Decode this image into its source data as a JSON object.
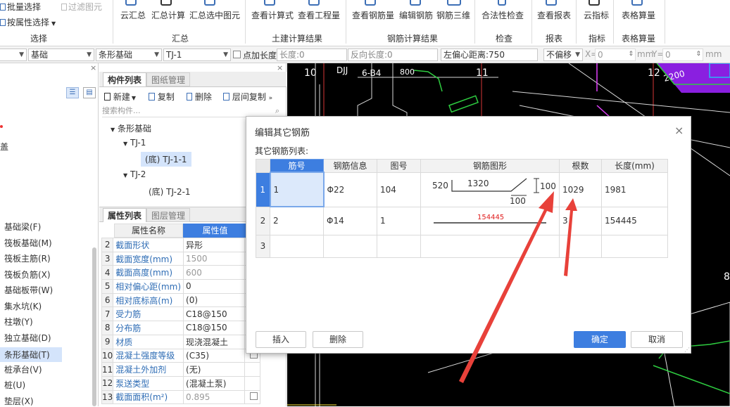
{
  "ribbon": {
    "select_group": {
      "batch_select": "批量选择",
      "filter_select": "过滤图元",
      "select_by_attr": "按属性选择",
      "label": "选择"
    },
    "summary_group": {
      "cloud_summary": "云汇总",
      "summary_calc": "汇总计算",
      "summary_selected": "汇总选中图元",
      "label": "汇总"
    },
    "civil_group": {
      "view_formula": "查看计算式",
      "view_quantity": "查看工程量",
      "label": "土建计算结果"
    },
    "rebar_group": {
      "view_rebar_qty": "查看钢筋量",
      "edit_rebar": "编辑钢筋",
      "rebar_3d": "钢筋三维",
      "label": "钢筋计算结果"
    },
    "check_group": {
      "legality_check": "合法性检查",
      "label": "检查"
    },
    "report_group": {
      "view_report": "查看报表",
      "label": "报表"
    },
    "index_group": {
      "cloud_index": "云指标",
      "label": "指标"
    },
    "table_group": {
      "table_calc": "表格算量",
      "label": "表格算量"
    }
  },
  "toolbar2": {
    "floor_value": "基础",
    "type_value": "条形基础",
    "component_value": "TJ-1",
    "point_length_label": "点加长度",
    "length_label": "长度:",
    "length_value": "0",
    "reverse_label": "反向长度:",
    "reverse_value": "0",
    "left_offset_label": "左偏心距离:",
    "left_offset_value": "750",
    "offset_mode": "不偏移",
    "x_label": "X=",
    "x_value": "0",
    "x_unit": "mm",
    "y_label": "Y=",
    "y_value": "0",
    "y_unit": "mm"
  },
  "nav": {
    "cover_text": "盖",
    "items": [
      "基础梁(F)",
      "筏板基础(M)",
      "筏板主筋(R)",
      "筏板负筋(X)",
      "基础板带(W)",
      "集水坑(K)",
      "柱墩(Y)",
      "独立基础(D)",
      "条形基础(T)",
      "桩承台(V)",
      "桩(U)",
      "垫层(X)"
    ]
  },
  "comp": {
    "tab_list": "构件列表",
    "tab_drawing": "图纸管理",
    "new_btn": "新建",
    "copy_btn": "复制",
    "delete_btn": "删除",
    "floor_copy_btn": "层间复制",
    "search_placeholder": "搜索构件...",
    "tree_root": "条形基础",
    "tj1": "TJ-1",
    "tj1_child": "(底) TJ-1-1",
    "tj2": "TJ-2",
    "tj2_child": "(底) TJ-2-1"
  },
  "props": {
    "tab_attr": "属性列表",
    "tab_layer": "图层管理",
    "col_name": "属性名称",
    "col_value": "属性值",
    "rows": [
      {
        "n": "2",
        "k": "截面形状",
        "v": "异形",
        "g": false
      },
      {
        "n": "3",
        "k": "截面宽度(mm)",
        "v": "1500",
        "g": true
      },
      {
        "n": "4",
        "k": "截面高度(mm)",
        "v": "600",
        "g": true
      },
      {
        "n": "5",
        "k": "相对偏心距(mm)",
        "v": "0",
        "g": false
      },
      {
        "n": "6",
        "k": "相对底标高(m)",
        "v": "(0)",
        "g": false
      },
      {
        "n": "7",
        "k": "受力筋",
        "v": "C18@150",
        "g": false
      },
      {
        "n": "8",
        "k": "分布筋",
        "v": "C18@150",
        "g": false
      },
      {
        "n": "9",
        "k": "材质",
        "v": "现浇混凝土",
        "g": false
      },
      {
        "n": "10",
        "k": "混凝土强度等级",
        "v": "(C35)",
        "g": false
      },
      {
        "n": "11",
        "k": "混凝土外加剂",
        "v": "(无)",
        "g": false
      },
      {
        "n": "12",
        "k": "泵送类型",
        "v": "(混凝土泵)",
        "g": false
      },
      {
        "n": "13",
        "k": "截面面积(m²)",
        "v": "0.895",
        "g": true
      }
    ]
  },
  "cad": {
    "axis_10": "10",
    "axis_11": "11",
    "axis_12": "12",
    "label_dj": "DJJ",
    "label_b4": "6-B4",
    "label_800": "800",
    "label_2200": "2200",
    "label_8": "8"
  },
  "dialog": {
    "title": "编辑其它钢筋",
    "subtitle": "其它钢筋列表:",
    "headers": [
      "筋号",
      "钢筋信息",
      "图号",
      "钢筋图形",
      "根数",
      "长度(mm)"
    ],
    "rows": [
      {
        "idx": "1",
        "no": "1",
        "info": "Φ22",
        "fig": "104",
        "count": "1029",
        "length": "1981"
      },
      {
        "idx": "2",
        "no": "2",
        "info": "Φ14",
        "fig": "1",
        "count": "3",
        "length": "154445"
      },
      {
        "idx": "3",
        "no": "",
        "info": "",
        "fig": "",
        "count": "",
        "length": ""
      }
    ],
    "shape1": {
      "a": "520",
      "b": "1320",
      "c": "100",
      "d": "100"
    },
    "shape2_label": "154445",
    "insert_btn": "插入",
    "delete_btn": "删除",
    "ok_btn": "确定",
    "cancel_btn": "取消"
  },
  "colors": {
    "accent": "#3d7ee0",
    "annotation_arrow": "#e8413a",
    "cad_bg": "#000000"
  }
}
